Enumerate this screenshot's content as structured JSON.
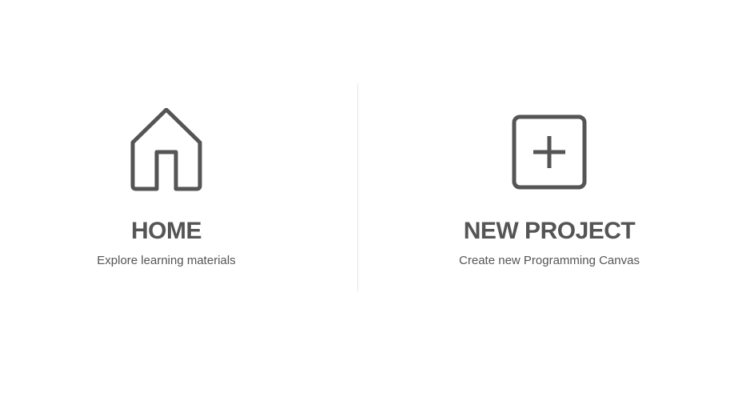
{
  "home": {
    "title": "HOME",
    "subtitle": "Explore learning materials",
    "icon": "house-icon"
  },
  "new_project": {
    "title": "NEW PROJECT",
    "subtitle": "Create new Programming Canvas",
    "icon": "plus-square-icon"
  },
  "colors": {
    "text": "#555555",
    "icon_stroke": "#555555",
    "divider": "#e6e6e6",
    "background": "#ffffff"
  }
}
